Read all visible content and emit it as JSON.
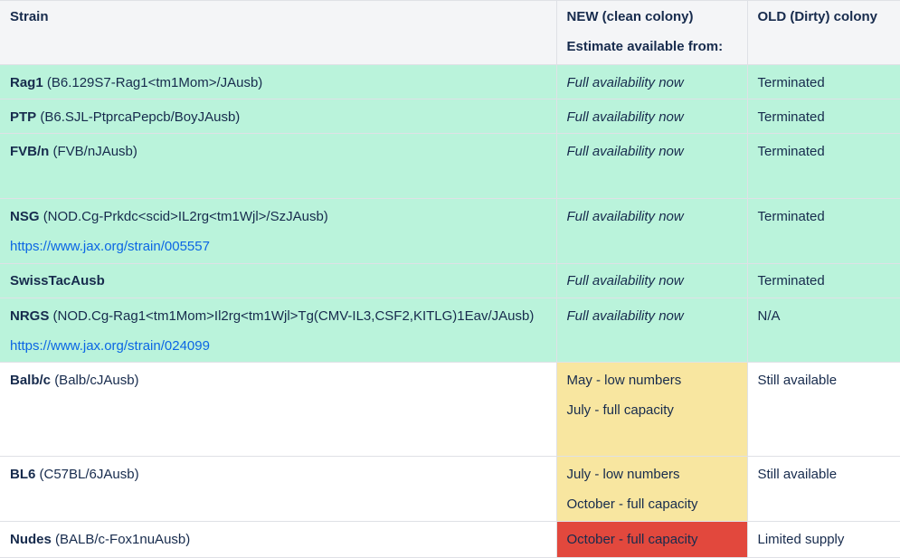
{
  "headers": {
    "strain": "Strain",
    "new_line1": "NEW (clean colony)",
    "new_line2": "Estimate available from:",
    "old": "OLD (Dirty) colony"
  },
  "rows": [
    {
      "name": "Rag1",
      "detail": "(B6.129S7-Rag1<tm1Mom>/JAusb)",
      "new1": "Full availability now",
      "old": "Terminated"
    },
    {
      "name": "PTP",
      "detail": "(B6.SJL-PtprcaPepcb/BoyJAusb)",
      "new1": "Full availability now",
      "old": "Terminated"
    },
    {
      "name": "FVB/n",
      "detail": "(FVB/nJAusb)",
      "new1": "Full availability now",
      "old": "Terminated"
    },
    {
      "name": "NSG",
      "detail": "(NOD.Cg-Prkdc<scid>IL2rg<tm1Wjl>/SzJAusb)",
      "link": "https://www.jax.org/strain/005557",
      "new1": "Full availability now",
      "old": "Terminated"
    },
    {
      "name": "SwissTacAusb",
      "detail": "",
      "new1": "Full availability now",
      "old": "Terminated"
    },
    {
      "name": "NRGS",
      "detail": "(NOD.Cg-Rag1<tm1Mom>Il2rg<tm1Wjl>Tg(CMV-IL3,CSF2,KITLG)1Eav/JAusb)",
      "link": "https://www.jax.org/strain/024099",
      "new1": "Full availability now",
      "old": "N/A"
    },
    {
      "name": "Balb/c",
      "detail": "(Balb/cJAusb)",
      "new1": "May - low numbers",
      "new2": "July - full capacity",
      "old": "Still available"
    },
    {
      "name": "BL6",
      "detail": "(C57BL/6JAusb)",
      "new1": "July - low numbers",
      "new2": "October - full capacity",
      "old": "Still available"
    },
    {
      "name": "Nudes",
      "detail": "(BALB/c-Fox1nuAusb)",
      "new1": "October - full capacity",
      "old": "Limited supply"
    }
  ],
  "colors": {
    "green": "#baf3db",
    "yellow": "#f8e6a0",
    "red": "#e2483d",
    "header": "#f4f5f7",
    "link": "#0c66e4"
  }
}
